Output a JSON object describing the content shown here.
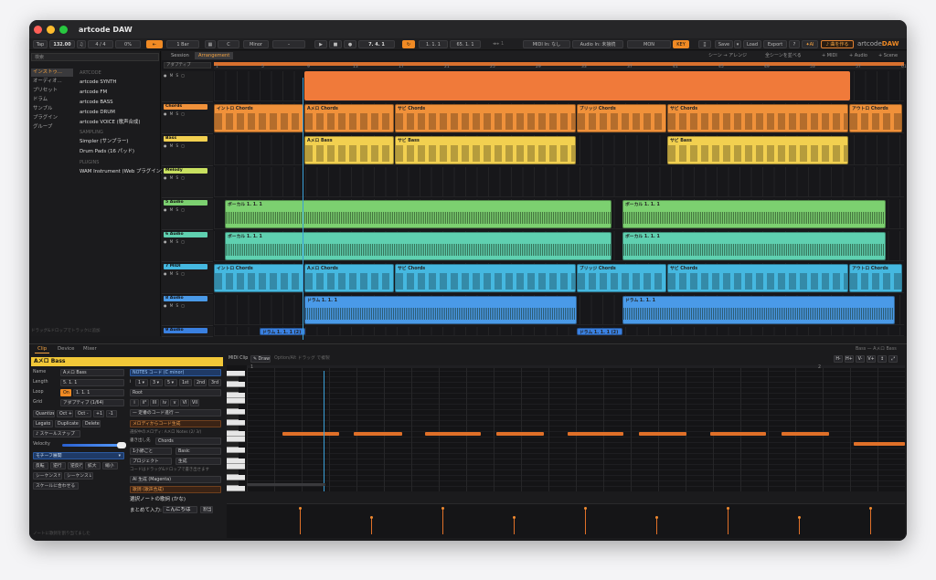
{
  "app_title": "artcode DAW",
  "transport": {
    "tap": "Tap",
    "bpm": "132.00",
    "sig": "4 / 4",
    "swing": "0%",
    "bar": "1 Bar",
    "key_root": "C",
    "scale": "Minor",
    "position": "7. 4. 1",
    "loop_start": "1. 1. 1",
    "loop_end": "65. 1. 1",
    "midi_in": "MIDI In: なし",
    "audio_in": "Audio In: 未接続",
    "mon": "MON",
    "key": "KEY",
    "save": "Save",
    "load": "Load",
    "export": "Export",
    "help": "?",
    "ai": "AI",
    "compose": "曲を作る",
    "brand_a": "artcode",
    "brand_b": "DAW"
  },
  "browser": {
    "search": "検索",
    "categories": [
      "インストゥ...",
      "オーディオ...",
      "プリセット",
      "ドラム",
      "サンプル",
      "プラグイン",
      "グループ"
    ],
    "head_artcode": "ARTCODE",
    "items_artcode": [
      "artcode SYNTH",
      "artcode FM",
      "artcode BASS",
      "artcode DRUM",
      "artcode VOICE (歌声合成)"
    ],
    "head_sampling": "SAMPLING",
    "items_sampling": [
      "Simpler (サンプラー)",
      "Drum Pads (16 パッド)"
    ],
    "head_plugins": "PLUGINS",
    "items_plugins": [
      "WAM Instrument (Web プラグイン)"
    ],
    "footer": "ドラッグ&ドロップでトラックに追加"
  },
  "arrangement": {
    "tab_session": "Session",
    "tab_arrangement": "Arrangement",
    "scene_arrange": "シーン → アレンジ",
    "all_scenes": "全シーンを並べる",
    "add_midi": "+ MIDI",
    "add_audio": "+ Audio",
    "add_scene": "+ Scene",
    "adaptive": "アダプティブ",
    "ruler": [
      "1",
      "5",
      "9",
      "13",
      "17",
      "21",
      "25",
      "29",
      "33",
      "37",
      "41",
      "45",
      "49",
      "53",
      "57",
      "61"
    ],
    "tracks": [
      {
        "name": "",
        "color": "#f07a3a"
      },
      {
        "name": "Chords",
        "color": "#f0913a"
      },
      {
        "name": "Bass",
        "color": "#f2d050"
      },
      {
        "name": "Melody",
        "color": "#c8e060"
      },
      {
        "name": "5 Audio",
        "color": "#7cd070"
      },
      {
        "name": "6 Audio",
        "color": "#5fd0b0"
      },
      {
        "name": "7 MIDI",
        "color": "#45b8e0"
      },
      {
        "name": "8 Audio",
        "color": "#4a9ae8"
      },
      {
        "name": "9 Audio",
        "color": "#3a80e0"
      }
    ],
    "chords_clips": [
      "イントロ Chords",
      "Aメロ Chords",
      "サビ Chords",
      "ブリッジ Chords",
      "サビ Chords",
      "アウトロ Chords"
    ],
    "bass_clips": [
      "Aメロ Bass",
      "サビ Bass",
      "サビ Bass"
    ],
    "vocal_clips": [
      "ボーカル 1. 1. 1",
      "ボーカル 1. 1. 1"
    ],
    "vocal2_clips": [
      "ボーカル 1. 1. 1",
      "ボーカル 1. 1. 1"
    ],
    "midi_clips": [
      "イントロ Chords",
      "Aメロ Chords",
      "サビ Chords",
      "ブリッジ Chords",
      "サビ Chords",
      "アウトロ Chords"
    ],
    "drum_clips": [
      "ドラム 1. 1. 1",
      "ドラム 1. 1. 1"
    ],
    "nine_clips": [
      "ドラム 1. 1. 1 (2)",
      "ドラム 1. 1. 1 (2)"
    ]
  },
  "detail": {
    "tab_clip": "Clip",
    "tab_device": "Device",
    "tab_mixer": "Mixer",
    "clip_name": "Aメロ Bass",
    "name_label": "Name",
    "name_value": "Aメロ Bass",
    "length_label": "Length",
    "length_value": "5. 1. 1",
    "loop_label": "Loop",
    "loop_on": "On",
    "loop_value": "1. 1. 1",
    "grid_label": "Grid",
    "grid_value": "アダプティブ (1/64)",
    "quantize": "Quantize",
    "oct_up": "Oct +",
    "oct_down": "Oct -",
    "plus1": "+1",
    "minus1": "-1",
    "legato": "Legato",
    "duplicate": "Duplicate",
    "delete": "Delete",
    "scale_snap": "♪ スケールスナップ",
    "velocity": "Velocity",
    "motif": "モチーフ展開",
    "btns": [
      "反転",
      "逆行",
      "逆反行",
      "拡大",
      "縮小"
    ],
    "seq1": "シーケンス↑",
    "seq2": "シーケンス↓",
    "fit_scale": "スケールに合わせる",
    "notes_header": "NOTES コード (C minor)",
    "deg_i": "I",
    "deg_1": "1 ▾",
    "deg_3": "3 ▾",
    "deg_5": "5 ▾",
    "deg_1st": "1st",
    "deg_2nd": "2nd",
    "deg_3rd": "3rd",
    "root": "Root",
    "roman": [
      "i",
      "ii°",
      "III",
      "iv",
      "v",
      "VI",
      "VII"
    ],
    "progression": "— 定番のコード進行 —",
    "gen_chords": "メロディからコード生成",
    "gen_hint": "選択中のメロディ: Aメロ Notes (2/ 3/)",
    "dest_label": "書き出し先",
    "dest_value": "Chords",
    "bars": "1小節ごと",
    "basic": "Basic",
    "project": "プロジェクト",
    "generate": "生成",
    "code_hint": "コードはドラッグ&ドロップで書き出せます",
    "ai_gen": "AI 生成 (Magenta)",
    "lyrics_head": "歌詞 (歌声合成)",
    "lyrics_sel": "選択ノートの歌詞 (かな)",
    "lyrics_input_label": "まとめて入力:",
    "lyrics_input_value": "こんにちは",
    "lyrics_apply": "割当",
    "midi_clip": "MIDI Clip",
    "draw": "✎ Draw",
    "option_hint": "Option/Alt ドラッグ で複製",
    "bass_ref": "Bass — Aメロ Bass",
    "status": "ノートに歌詞を割り当てました",
    "bar1": "1",
    "bar2": "2"
  }
}
